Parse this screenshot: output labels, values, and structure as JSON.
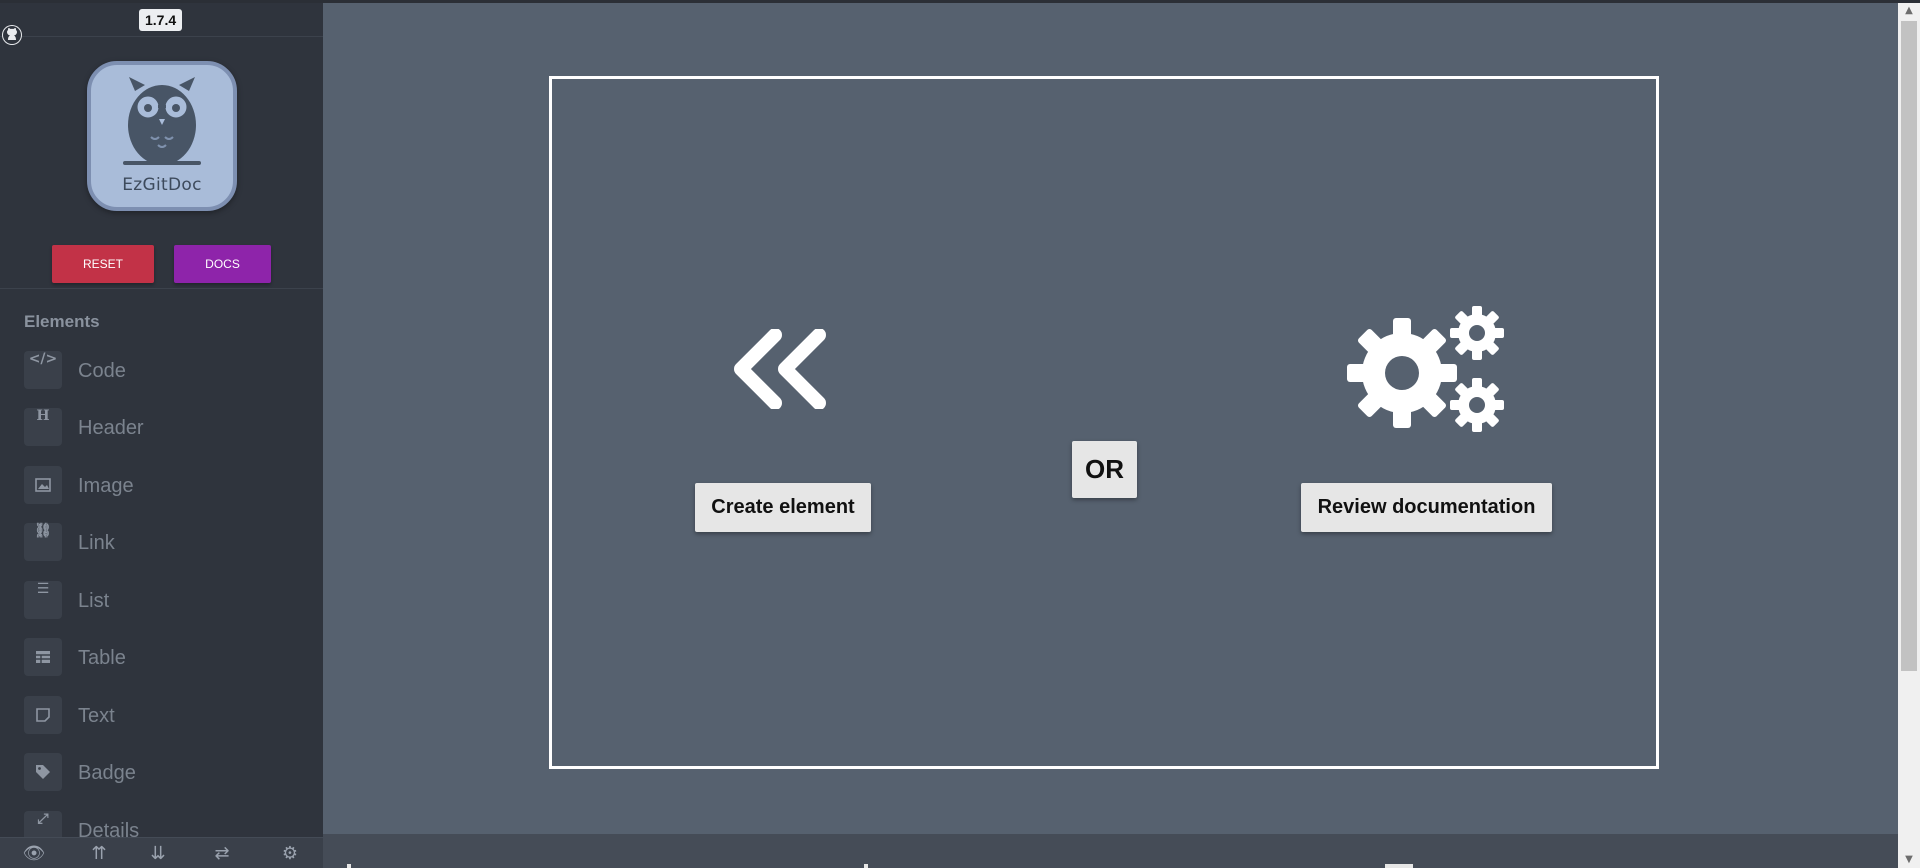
{
  "app": {
    "version": "1.7.4",
    "logo_text": "EzGitDoc",
    "reset_label": "RESET",
    "docs_label": "DOCS",
    "github_icon": "github-icon"
  },
  "sidebar": {
    "section_title": "Elements",
    "items": [
      {
        "label": "Code",
        "icon": "code-icon"
      },
      {
        "label": "Header",
        "icon": "header-icon"
      },
      {
        "label": "Image",
        "icon": "image-icon"
      },
      {
        "label": "Link",
        "icon": "link-icon"
      },
      {
        "label": "List",
        "icon": "list-icon"
      },
      {
        "label": "Table",
        "icon": "table-icon"
      },
      {
        "label": "Text",
        "icon": "text-icon"
      },
      {
        "label": "Badge",
        "icon": "badge-icon"
      },
      {
        "label": "Details",
        "icon": "details-icon"
      }
    ],
    "footer_icons": [
      "eye-icon",
      "collapse-all-icon",
      "expand-all-icon",
      "swap-icon",
      "gear-icon"
    ]
  },
  "main": {
    "create_label": "Create element",
    "or_label": "OR",
    "review_label": "Review documentation"
  },
  "colors": {
    "sidebar_bg": "#2f343d",
    "main_bg": "#56616f",
    "reset": "#c23247",
    "docs": "#8e24aa",
    "logo_bg": "#a9bcd9"
  }
}
